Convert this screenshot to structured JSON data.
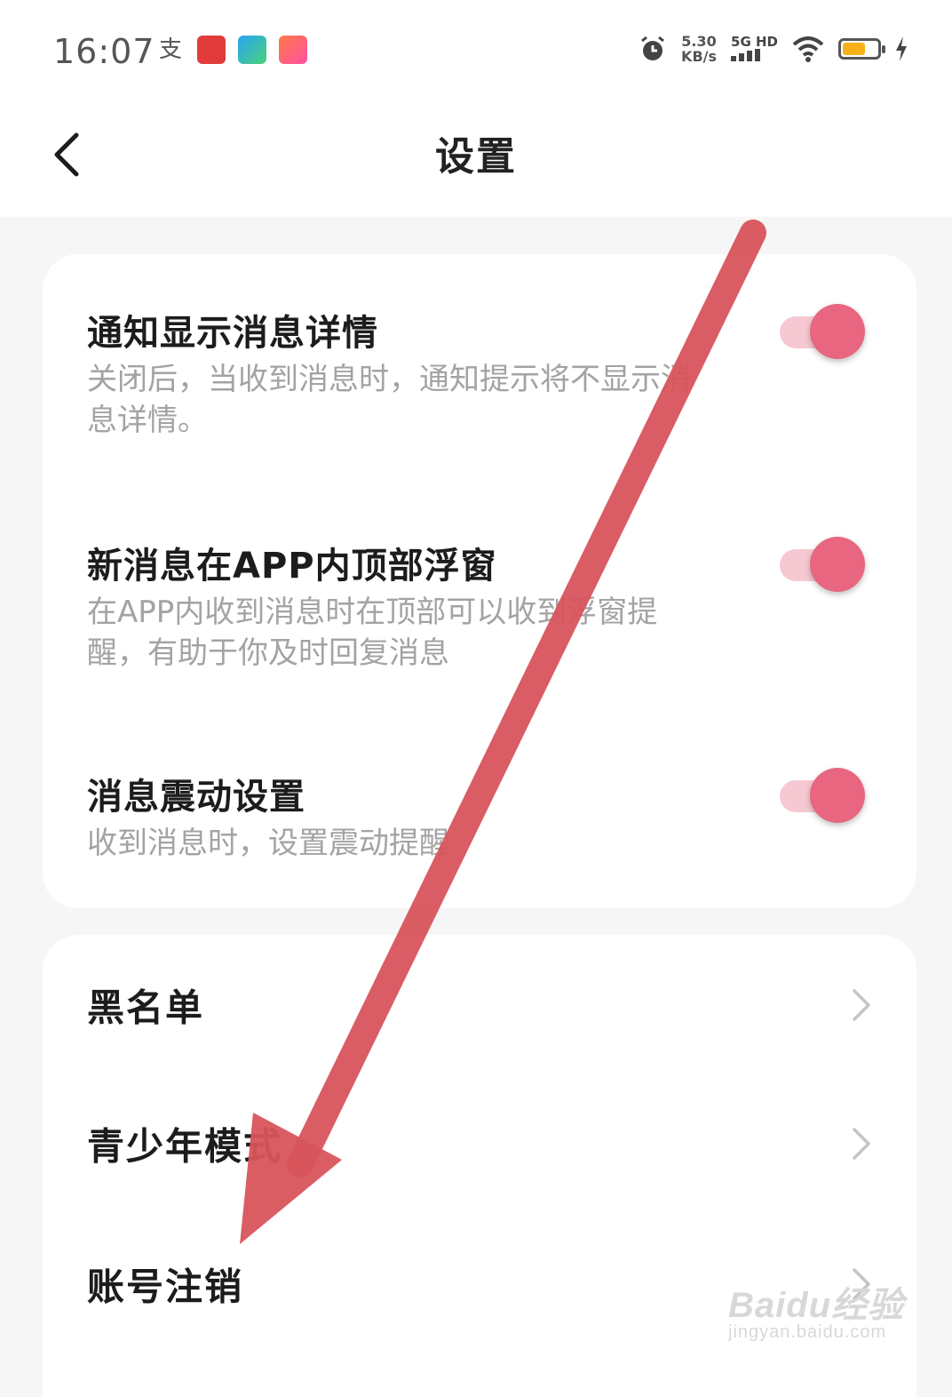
{
  "status_bar": {
    "time": "16:07",
    "left_icons": [
      "alipay-icon",
      "app-red-icon",
      "app-blue-icon",
      "app-orange-icon"
    ],
    "net_speed_value": "5.30",
    "net_speed_unit": "KB/s",
    "network": "5G HD",
    "right_icons": [
      "alarm-icon",
      "signal-icon",
      "wifi-icon",
      "battery-icon",
      "charging-icon"
    ],
    "battery_level": 0.6,
    "battery_color": "#f6b11a"
  },
  "header": {
    "title": "设置",
    "back_icon": "back-chevron-icon"
  },
  "notification_settings": [
    {
      "title": "通知显示消息详情",
      "description": "关闭后，当收到消息时，通知提示将不显示消息详情。",
      "enabled": true
    },
    {
      "title": "新消息在APP内顶部浮窗",
      "description": "在APP内收到消息时在顶部可以收到浮窗提醒，有助于你及时回复消息",
      "enabled": true
    },
    {
      "title": "消息震动设置",
      "description": "收到消息时，设置震动提醒",
      "enabled": true
    }
  ],
  "links": [
    {
      "label": "黑名单"
    },
    {
      "label": "青少年模式"
    },
    {
      "label": "账号注销"
    }
  ],
  "colors": {
    "toggle_on": "#e8667f",
    "toggle_track": "#f6c8d2",
    "annotation_arrow": "#d9545c"
  },
  "watermark": {
    "brand": "Baidu经验",
    "url": "jingyan.baidu.com"
  }
}
